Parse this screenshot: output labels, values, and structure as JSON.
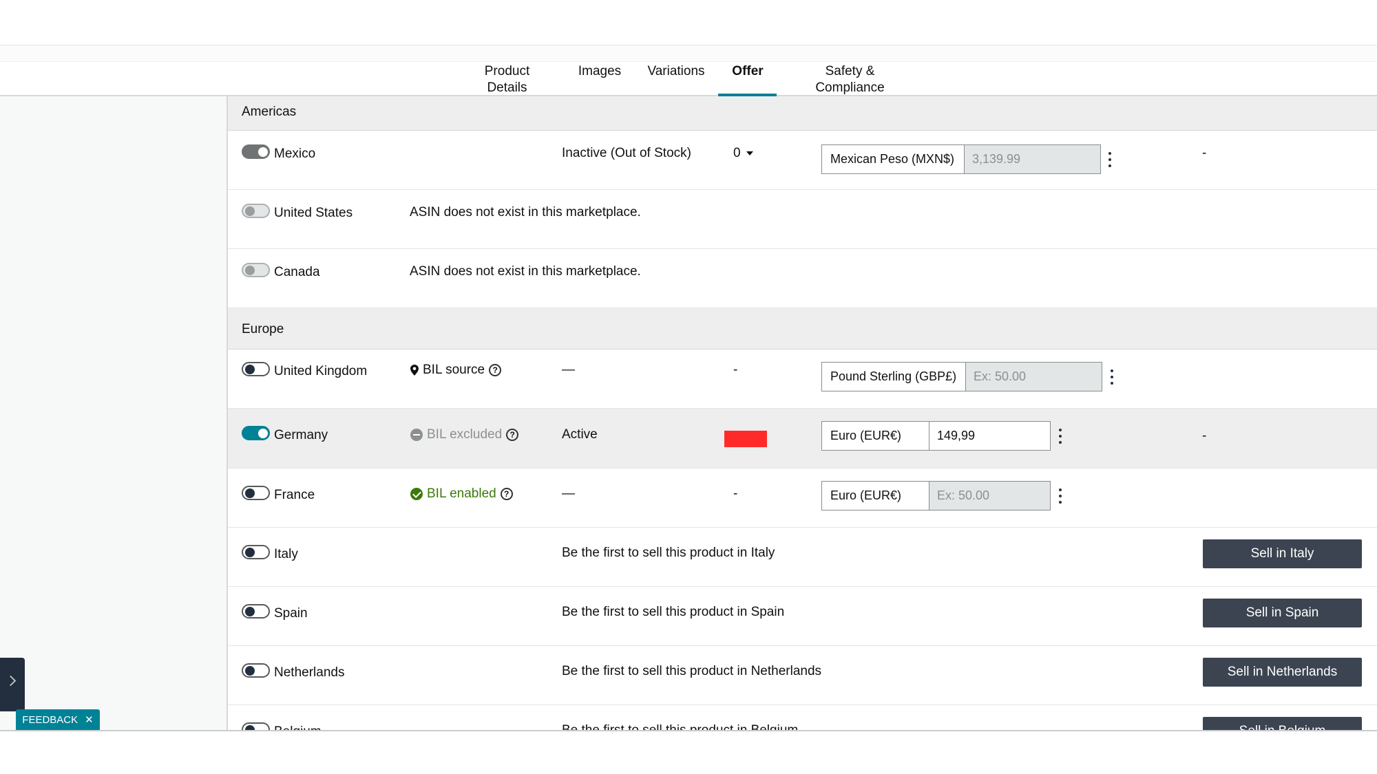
{
  "tabs": [
    {
      "label": "Product Details"
    },
    {
      "label": "Images"
    },
    {
      "label": "Variations"
    },
    {
      "label": "Offer"
    },
    {
      "label": "Safety & Compliance"
    }
  ],
  "active_tab": "Offer",
  "accent_color": "#008296",
  "sections": {
    "americas": "Americas",
    "europe": "Europe"
  },
  "rows": {
    "mexico": {
      "country": "Mexico",
      "status": "Inactive (Out of Stock)",
      "quantity": "0",
      "currency": "Mexican Peso (MXN$)",
      "price": "3,139.99",
      "dash": "-"
    },
    "us": {
      "country": "United States",
      "message": "ASIN does not exist in this marketplace."
    },
    "canada": {
      "country": "Canada",
      "message": "ASIN does not exist in this marketplace."
    },
    "uk": {
      "country": "United Kingdom",
      "bil": "BIL source",
      "status": "—",
      "quantity": "-",
      "currency": "Pound Sterling (GBP£)",
      "price_placeholder": "Ex: 50.00"
    },
    "germany": {
      "country": "Germany",
      "bil": "BIL excluded",
      "status": "Active",
      "currency": "Euro (EUR€)",
      "price": "149,99",
      "dash": "-"
    },
    "france": {
      "country": "France",
      "bil": "BIL enabled",
      "status": "—",
      "quantity": "-",
      "currency": "Euro (EUR€)",
      "price_placeholder": "Ex: 50.00"
    },
    "italy": {
      "country": "Italy",
      "message": "Be the first to sell this product in Italy",
      "button": "Sell in Italy"
    },
    "spain": {
      "country": "Spain",
      "message": "Be the first to sell this product in Spain",
      "button": "Sell in Spain"
    },
    "netherlands": {
      "country": "Netherlands",
      "message": "Be the first to sell this product in Netherlands",
      "button": "Sell in Netherlands"
    },
    "belgium": {
      "country": "Belgium",
      "message": "Be the first to sell this product in Belgium",
      "button": "Sell in Belgium"
    }
  },
  "help_glyph": "?",
  "feedback": {
    "label": "FEEDBACK",
    "close": "✕"
  }
}
